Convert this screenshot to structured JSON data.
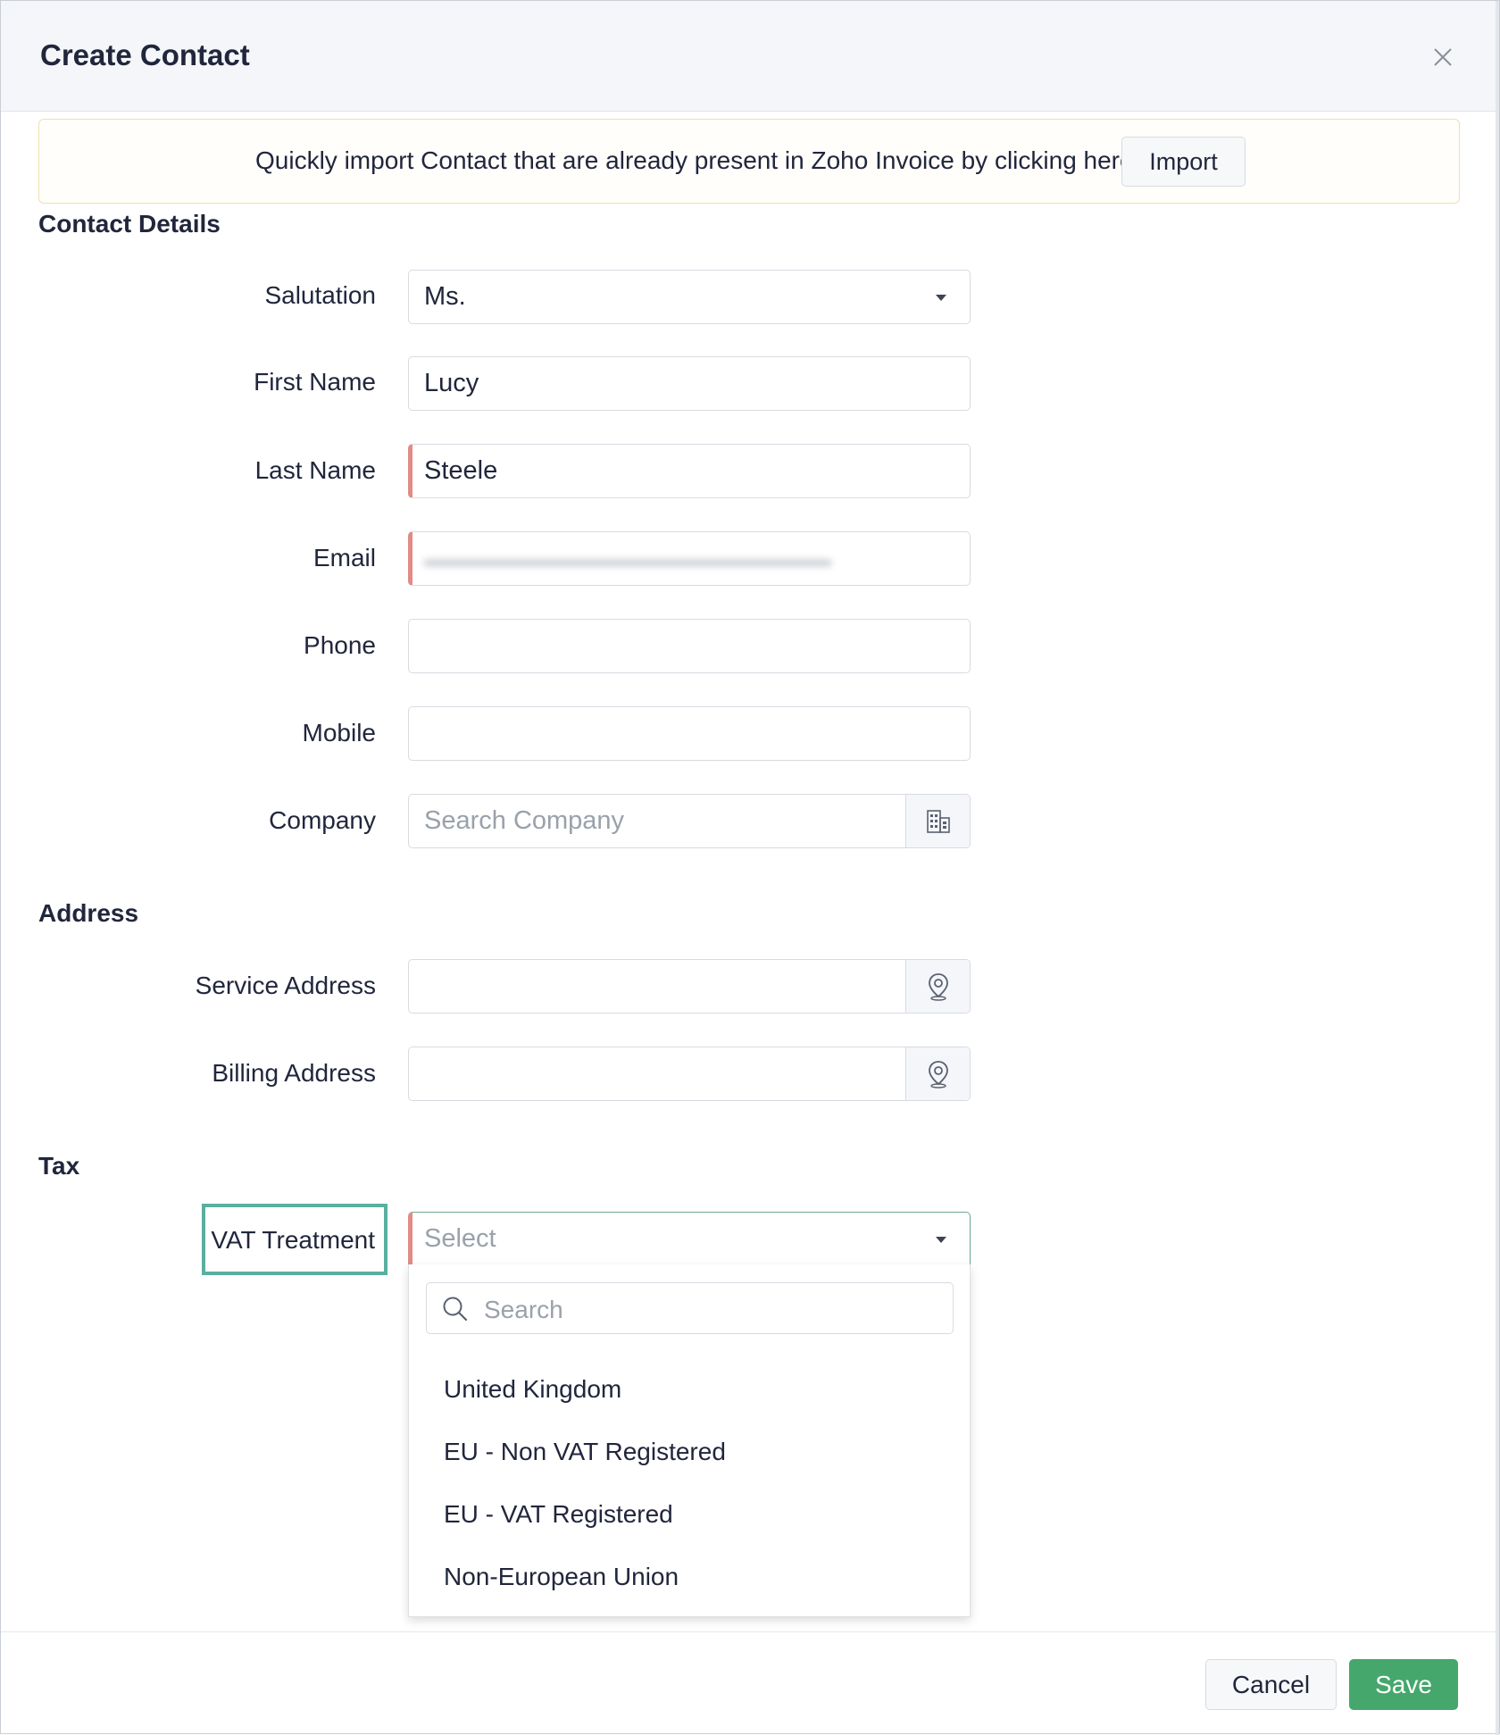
{
  "dialog": {
    "title": "Create Contact"
  },
  "banner": {
    "text": "Quickly import Contact that are already present in Zoho Invoice by clicking here",
    "import_label": "Import"
  },
  "contact_details": {
    "section_title": "Contact Details",
    "salutation": {
      "label": "Salutation",
      "value": "Ms."
    },
    "first_name": {
      "label": "First Name",
      "value": "Lucy"
    },
    "last_name": {
      "label": "Last Name",
      "value": "Steele"
    },
    "email": {
      "label": "Email",
      "value": "",
      "note": "value blurred"
    },
    "phone": {
      "label": "Phone",
      "value": ""
    },
    "mobile": {
      "label": "Mobile",
      "value": ""
    },
    "company": {
      "label": "Company",
      "placeholder": "Search Company",
      "icon": "building-icon"
    }
  },
  "address": {
    "section_title": "Address",
    "service_address": {
      "label": "Service Address",
      "value": "",
      "icon": "location-pin-icon"
    },
    "billing_address": {
      "label": "Billing Address",
      "value": "",
      "icon": "location-pin-icon"
    }
  },
  "tax": {
    "section_title": "Tax",
    "vat_treatment": {
      "label": "VAT Treatment",
      "placeholder": "Select",
      "search_placeholder": "Search",
      "options": [
        "United Kingdom",
        "EU - Non VAT Registered",
        "EU - VAT Registered",
        "Non-European Union"
      ]
    }
  },
  "footer": {
    "cancel_label": "Cancel",
    "save_label": "Save"
  },
  "colors": {
    "save_button": "#45a76b",
    "required_marker": "#e08b86",
    "highlight_box": "#5aaf9f"
  }
}
